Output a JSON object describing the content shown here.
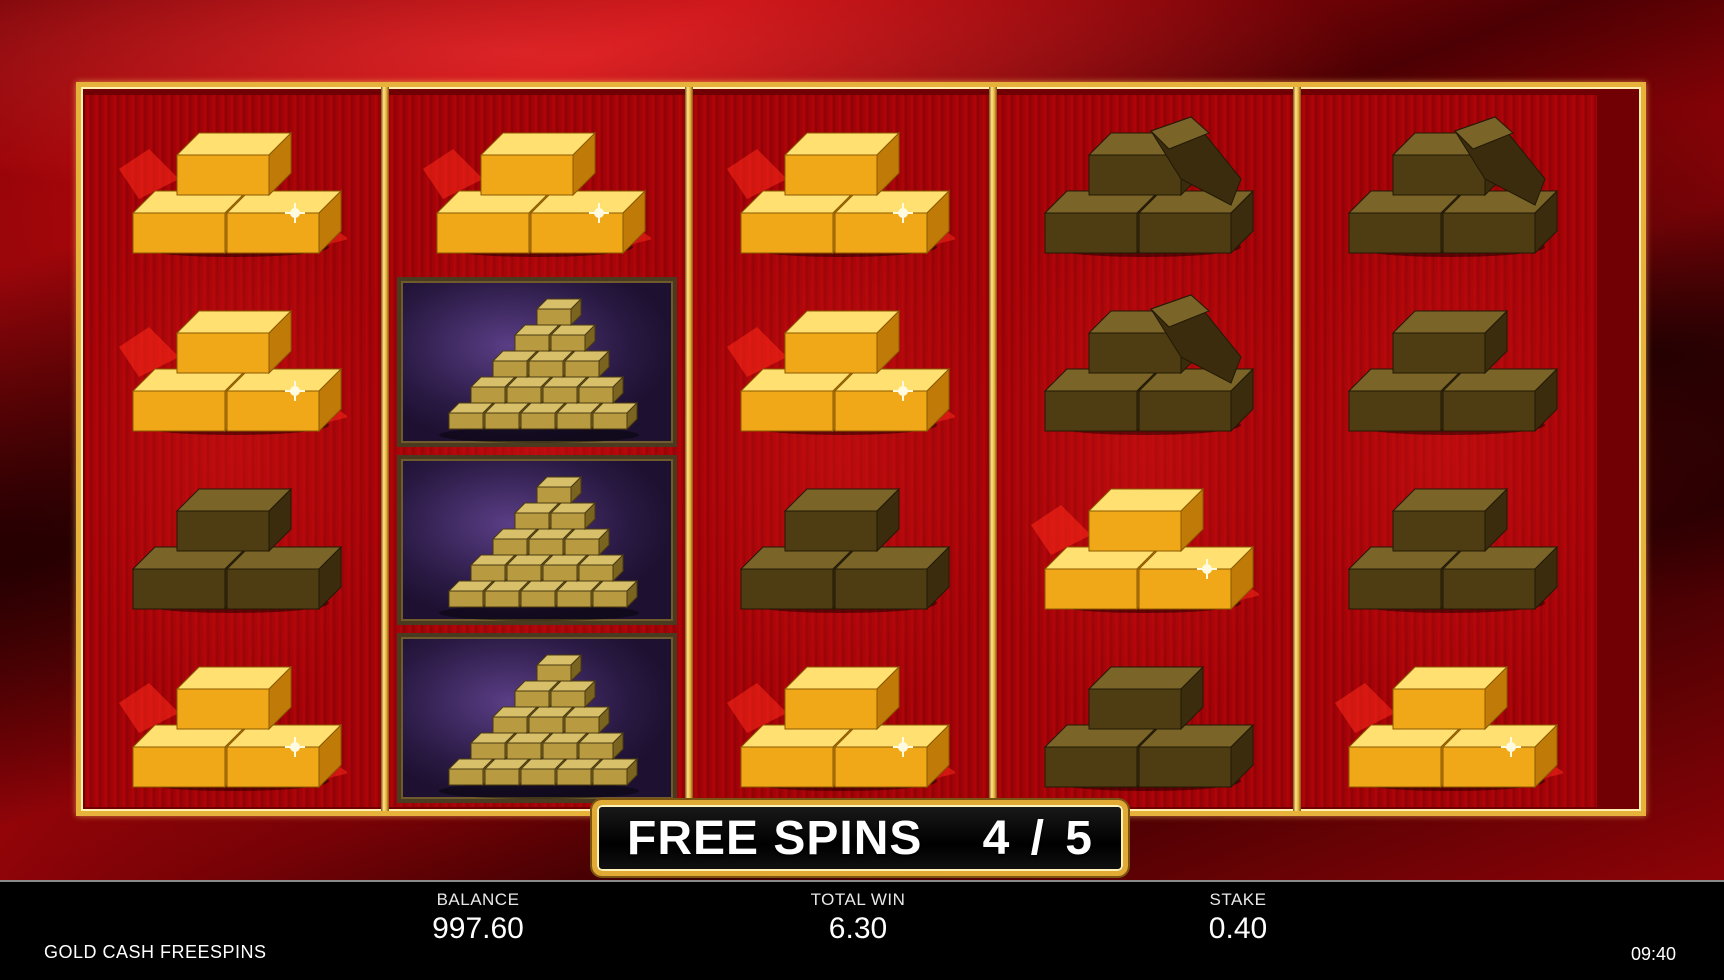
{
  "game": {
    "banner": {
      "label": "FREE SPINS",
      "count": "4 / 5"
    },
    "reels": [
      [
        "gold-bars",
        "gold-bars",
        "bronze-bars",
        "gold-bars"
      ],
      [
        "gold-bars",
        "pyramid-bars",
        "pyramid-bars",
        "pyramid-bars"
      ],
      [
        "gold-bars",
        "gold-bars",
        "bronze-bars",
        "gold-bars"
      ],
      [
        "bronze-tipped-bars",
        "bronze-tipped-bars",
        "gold-bars",
        "bronze-bars"
      ],
      [
        "bronze-tipped-bars",
        "bronze-bars",
        "bronze-bars",
        "gold-bars"
      ]
    ],
    "colors": {
      "frame_gold": "#e6b23c",
      "gold_bar": "#f2b51f",
      "bronze_bar": "#5e4a1a",
      "pyramid_bg": "#3a2560",
      "background_red": "#a30409"
    }
  },
  "status_bar": {
    "balance_label": "BALANCE",
    "balance_value": "997.60",
    "total_win_label": "TOTAL WIN",
    "total_win_value": "6.30",
    "stake_label": "STAKE",
    "stake_value": "0.40",
    "game_name": "GOLD CASH FREESPINS",
    "clock": "09:40"
  }
}
